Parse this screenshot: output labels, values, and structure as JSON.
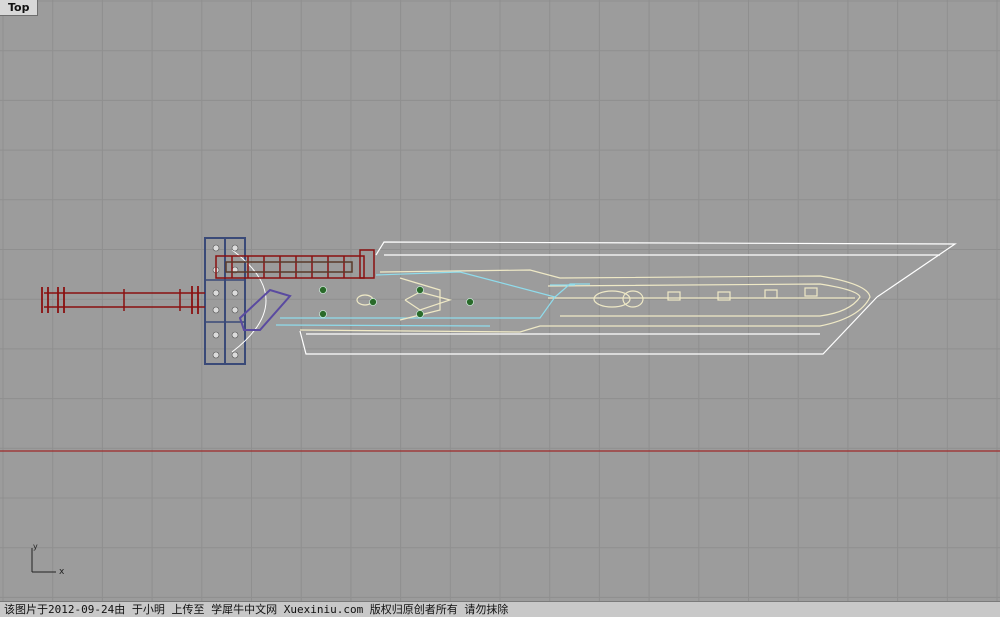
{
  "viewport": {
    "title": "Top",
    "colors": {
      "background": "#9c9c9c",
      "grid_minor": "#8f8f8f",
      "grid_major": "#878787",
      "x_axis": "#9e2a2a",
      "wire_white": "#ffffff",
      "wire_cyan": "#8fdcec",
      "wire_cream": "#efe9c6",
      "guard_blue": "#3a4a78",
      "hilt_red": "#8a1010",
      "accent_purple": "#5a4aa0",
      "rivet_green": "#2a6a2a"
    },
    "axis_icon": {
      "x_label": "x",
      "y_label": "y"
    },
    "model": {
      "name_icon": "sword-wireframe-icon",
      "parts": [
        "blade",
        "guard",
        "hilt",
        "pommel",
        "engraving-panel",
        "rivets"
      ]
    }
  },
  "footer": {
    "caption": "该图片于2012-09-24由 于小明 上传至 学犀牛中文网 Xuexiniu.com 版权归原创者所有 请勿抹除"
  }
}
